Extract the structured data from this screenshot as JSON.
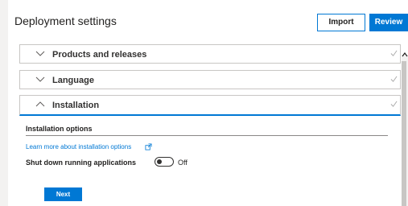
{
  "header": {
    "title": "Deployment settings",
    "import_label": "Import",
    "review_label": "Review"
  },
  "sections": [
    {
      "label": "Products and releases",
      "expanded": false,
      "completed": true
    },
    {
      "label": "Language",
      "expanded": false,
      "completed": true
    },
    {
      "label": "Installation",
      "expanded": true,
      "completed": true
    }
  ],
  "installation": {
    "heading": "Installation options",
    "learn_more_link": "Learn more about installation options",
    "shutdown_label": "Shut down running applications",
    "shutdown_state": "Off",
    "next_label": "Next"
  },
  "colors": {
    "accent": "#0078d4",
    "check": "#a6a6a6"
  },
  "icons": {
    "chevron_collapsed": "chevron-down-icon",
    "chevron_expanded": "chevron-up-icon",
    "completed": "checkmark-icon",
    "external_link": "external-link-icon"
  }
}
